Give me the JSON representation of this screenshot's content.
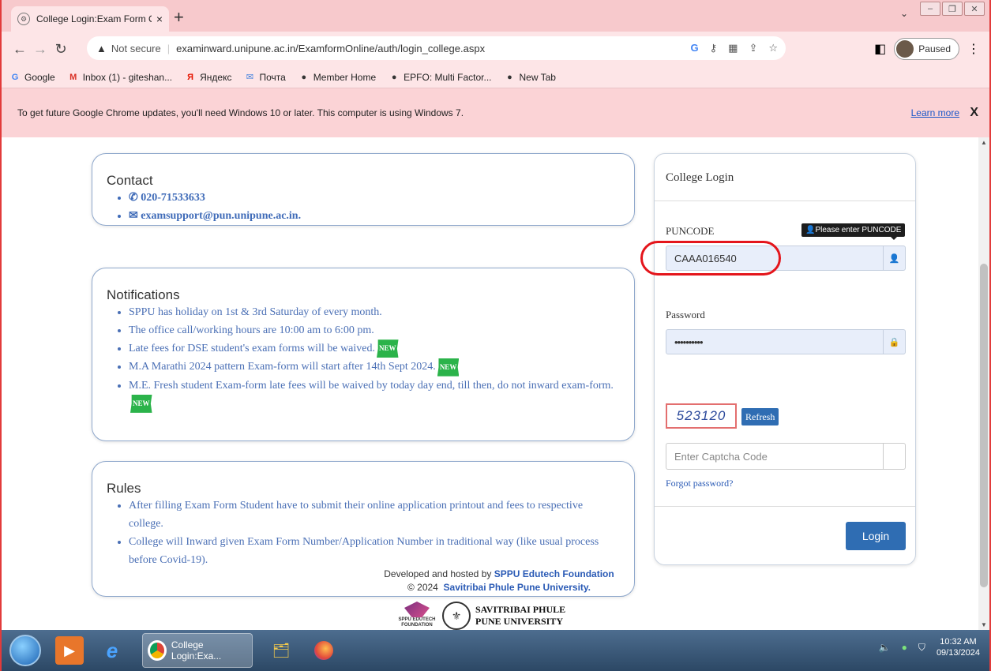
{
  "browser": {
    "tab_title": "College Login:Exam Form Online",
    "tab_close": "×",
    "new_tab": "+",
    "not_secure": "Not secure",
    "url": "examinward.unipune.ac.in/ExamformOnline/auth/login_college.aspx",
    "profile_status": "Paused",
    "bookmarks": [
      {
        "label": "Google",
        "icon": "G",
        "color": "#4285f4"
      },
      {
        "label": "Inbox (1) - giteshan...",
        "icon": "M",
        "color": "#d93025"
      },
      {
        "label": "Яндекс",
        "icon": "Я",
        "color": "#e61400"
      },
      {
        "label": "Почта",
        "icon": "✉",
        "color": "#3b7ddd"
      },
      {
        "label": "Member Home",
        "icon": "●",
        "color": "#333333"
      },
      {
        "label": "EPFO: Multi Factor...",
        "icon": "●",
        "color": "#333333"
      },
      {
        "label": "New Tab",
        "icon": "●",
        "color": "#333333"
      }
    ],
    "infobar_text": "To get future Google Chrome updates, you'll need Windows 10 or later. This computer is using Windows 7.",
    "infobar_link": "Learn more",
    "infobar_close": "X"
  },
  "contact": {
    "title": "Contact",
    "phone": "020-71533633",
    "email": "examsupport@pun.unipune.ac.in."
  },
  "notifications": {
    "title": "Notifications",
    "new_badge": "NEW",
    "items": [
      {
        "text": "SPPU has holiday on 1st & 3rd Saturday of every month.",
        "is_new": false
      },
      {
        "text": "The office call/working hours are 10:00 am to 6:00 pm.",
        "is_new": false
      },
      {
        "text": "Late fees for DSE student's exam forms will be waived.",
        "is_new": true
      },
      {
        "text": "M.A Marathi 2024 pattern Exam-form will start after 14th Sept 2024.",
        "is_new": true
      },
      {
        "text": "M.E. Fresh student Exam-form late fees will be waived by today day end, till then, do not inward exam-form.",
        "is_new": true
      }
    ]
  },
  "rules": {
    "title": "Rules",
    "items": [
      "After filling Exam Form Student have to submit their online application printout and fees to respective college.",
      "College will Inward given Exam Form Number/Application Number in traditional way (like usual process before Covid-19)."
    ]
  },
  "login": {
    "title": "College Login",
    "puncode_label": "PUNCODE",
    "puncode_value": "CAAA016540",
    "puncode_tooltip": "Please enter PUNCODE",
    "password_label": "Password",
    "password_value": "••••••••••",
    "captcha_code": "523120",
    "refresh_label": "Refresh",
    "captcha_placeholder": "Enter Captcha Code",
    "forgot_label": "Forgot password?",
    "login_label": "Login"
  },
  "footer": {
    "developed_prefix": "Developed and hosted by",
    "developer": "SPPU Edutech Foundation",
    "copyright_prefix": "© 2024",
    "university": "Savitribai Phule Pune University.",
    "logo_text": "SPPU EDUTECH FOUNDATION",
    "uni_line1": "SAVITRIBAI PHULE",
    "uni_line2": "PUNE UNIVERSITY"
  },
  "taskbar": {
    "active_window": "College Login:Exa...",
    "time": "10:32 AM",
    "date": "09/13/2024"
  }
}
